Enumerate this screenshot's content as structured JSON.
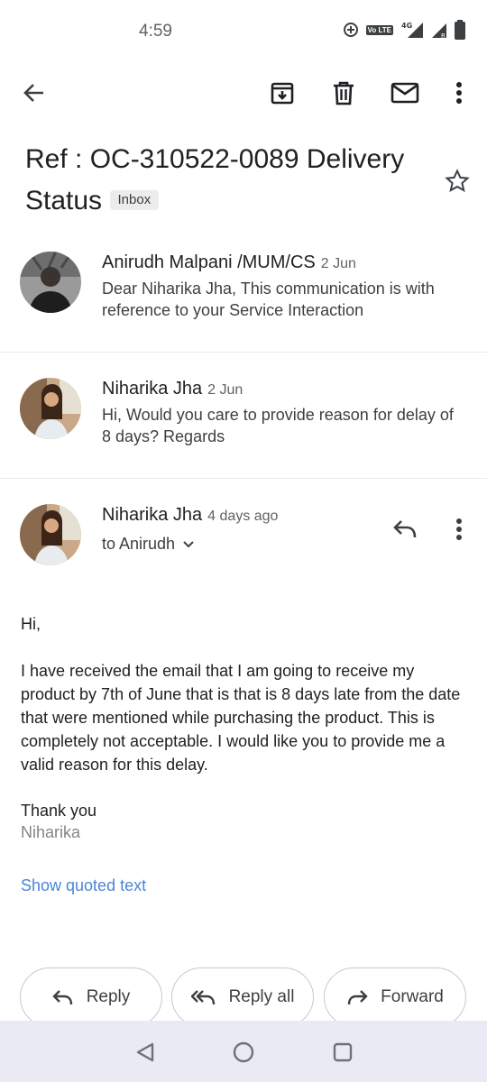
{
  "status_bar": {
    "time": "4:59",
    "volte_label": "Vo LTE",
    "network": "4G"
  },
  "toolbar": {
    "back": "back-arrow-icon",
    "archive": "archive-icon",
    "delete": "trash-icon",
    "mark_unread": "mail-icon",
    "more": "more-vert-icon"
  },
  "email": {
    "subject": "Ref : OC-310522-0089 Delivery Status",
    "label": "Inbox"
  },
  "messages": [
    {
      "sender": "Anirudh Malpani /MUM/CS",
      "date": "2 Jun",
      "snippet": "Dear Niharika Jha, This communication is with reference to your Service Interaction"
    },
    {
      "sender": "Niharika Jha",
      "date": "2 Jun",
      "snippet": "Hi, Would you care to provide reason for delay of 8 days? Regards"
    },
    {
      "sender": "Niharika Jha",
      "date": "4 days ago",
      "to": "to Anirudh"
    }
  ],
  "body": {
    "greeting": "Hi,",
    "paragraph": "I have received the email that I am going to receive my product by 7th of June that is  that is 8 days late from the date that were mentioned while purchasing the product. This is completely not acceptable. I would like you to provide me a valid reason for this delay.",
    "closing": "Thank you",
    "signature": "Niharika",
    "show_quoted": "Show quoted text"
  },
  "actions": {
    "reply": "Reply",
    "reply_all": "Reply all",
    "forward": "Forward"
  },
  "colors": {
    "link": "#4a86d6",
    "nav_bg": "#e9eaf3",
    "chip_bg": "#ececec"
  }
}
